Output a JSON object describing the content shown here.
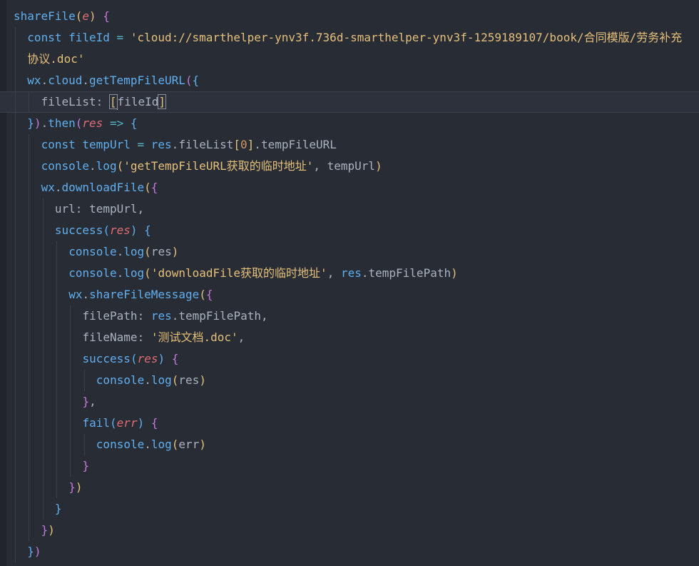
{
  "editor": {
    "lines": [
      {
        "indent": 0,
        "tokens": [
          [
            "t-fn",
            "shareFile"
          ],
          [
            "t-b1",
            "("
          ],
          [
            "t-param",
            "e"
          ],
          [
            "t-b1",
            ")"
          ],
          [
            "t-var",
            " "
          ],
          [
            "t-b2",
            "{"
          ]
        ]
      },
      {
        "indent": 1,
        "tokens": [
          [
            "t-kw",
            "const"
          ],
          [
            "t-var",
            " "
          ],
          [
            "t-obj",
            "fileId"
          ],
          [
            "t-var",
            " "
          ],
          [
            "t-op",
            "="
          ],
          [
            "t-var",
            " "
          ],
          [
            "t-str",
            "'cloud://smarthelper-ynv3f.736d-smarthelper-ynv3f-1259189107/book/合同模版/劳务补充"
          ]
        ]
      },
      {
        "indent": 1,
        "tokens": [
          [
            "t-str",
            "协议.doc'"
          ]
        ]
      },
      {
        "indent": 1,
        "tokens": [
          [
            "t-obj",
            "wx"
          ],
          [
            "t-var",
            "."
          ],
          [
            "t-obj",
            "cloud"
          ],
          [
            "t-var",
            "."
          ],
          [
            "t-fn",
            "getTempFileURL"
          ],
          [
            "t-b2",
            "("
          ],
          [
            "t-b3",
            "{"
          ]
        ]
      },
      {
        "indent": 2,
        "active": true,
        "tokens": [
          [
            "t-prop",
            "fileList"
          ],
          [
            "t-var",
            ": "
          ],
          [
            "t-b1",
            "[",
            "box"
          ],
          [
            "t-prop",
            "fileId"
          ],
          [
            "t-b1",
            "]",
            "box"
          ]
        ]
      },
      {
        "indent": 1,
        "tokens": [
          [
            "t-b3",
            "}"
          ],
          [
            "t-b2",
            ")"
          ],
          [
            "t-var",
            "."
          ],
          [
            "t-fn",
            "then"
          ],
          [
            "t-b2",
            "("
          ],
          [
            "t-param",
            "res"
          ],
          [
            "t-var",
            " "
          ],
          [
            "t-op",
            "=>"
          ],
          [
            "t-var",
            " "
          ],
          [
            "t-b3",
            "{"
          ]
        ]
      },
      {
        "indent": 2,
        "tokens": [
          [
            "t-kw",
            "const"
          ],
          [
            "t-var",
            " "
          ],
          [
            "t-obj",
            "tempUrl"
          ],
          [
            "t-var",
            " "
          ],
          [
            "t-op",
            "="
          ],
          [
            "t-var",
            " "
          ],
          [
            "t-obj",
            "res"
          ],
          [
            "t-var",
            "."
          ],
          [
            "t-prop",
            "fileList"
          ],
          [
            "t-b1",
            "["
          ],
          [
            "t-num",
            "0"
          ],
          [
            "t-b1",
            "]"
          ],
          [
            "t-var",
            "."
          ],
          [
            "t-prop",
            "tempFileURL"
          ]
        ]
      },
      {
        "indent": 2,
        "tokens": [
          [
            "t-obj",
            "console"
          ],
          [
            "t-var",
            "."
          ],
          [
            "t-fn",
            "log"
          ],
          [
            "t-b1",
            "("
          ],
          [
            "t-str",
            "'getTempFileURL获取的临时地址'"
          ],
          [
            "t-var",
            ", "
          ],
          [
            "t-prop",
            "tempUrl"
          ],
          [
            "t-b1",
            ")"
          ]
        ]
      },
      {
        "indent": 2,
        "tokens": [
          [
            "t-obj",
            "wx"
          ],
          [
            "t-var",
            "."
          ],
          [
            "t-fn",
            "downloadFile"
          ],
          [
            "t-b1",
            "("
          ],
          [
            "t-b2",
            "{"
          ]
        ]
      },
      {
        "indent": 3,
        "tokens": [
          [
            "t-prop",
            "url"
          ],
          [
            "t-var",
            ": "
          ],
          [
            "t-prop",
            "tempUrl"
          ],
          [
            "t-var",
            ","
          ]
        ]
      },
      {
        "indent": 3,
        "tokens": [
          [
            "t-fn",
            "success"
          ],
          [
            "t-b3",
            "("
          ],
          [
            "t-param",
            "res"
          ],
          [
            "t-b3",
            ")"
          ],
          [
            "t-var",
            " "
          ],
          [
            "t-b3",
            "{"
          ]
        ]
      },
      {
        "indent": 4,
        "tokens": [
          [
            "t-obj",
            "console"
          ],
          [
            "t-var",
            "."
          ],
          [
            "t-fn",
            "log"
          ],
          [
            "t-b1",
            "("
          ],
          [
            "t-prop",
            "res"
          ],
          [
            "t-b1",
            ")"
          ]
        ]
      },
      {
        "indent": 4,
        "tokens": [
          [
            "t-obj",
            "console"
          ],
          [
            "t-var",
            "."
          ],
          [
            "t-fn",
            "log"
          ],
          [
            "t-b1",
            "("
          ],
          [
            "t-str",
            "'downloadFile获取的临时地址'"
          ],
          [
            "t-var",
            ", "
          ],
          [
            "t-obj",
            "res"
          ],
          [
            "t-var",
            "."
          ],
          [
            "t-prop",
            "tempFilePath"
          ],
          [
            "t-b1",
            ")"
          ]
        ]
      },
      {
        "indent": 4,
        "tokens": [
          [
            "t-obj",
            "wx"
          ],
          [
            "t-var",
            "."
          ],
          [
            "t-fn",
            "shareFileMessage"
          ],
          [
            "t-b1",
            "("
          ],
          [
            "t-b2",
            "{"
          ]
        ]
      },
      {
        "indent": 5,
        "tokens": [
          [
            "t-prop",
            "filePath"
          ],
          [
            "t-var",
            ": "
          ],
          [
            "t-obj",
            "res"
          ],
          [
            "t-var",
            "."
          ],
          [
            "t-prop",
            "tempFilePath"
          ],
          [
            "t-var",
            ","
          ]
        ]
      },
      {
        "indent": 5,
        "tokens": [
          [
            "t-prop",
            "fileName"
          ],
          [
            "t-var",
            ": "
          ],
          [
            "t-str",
            "'测试文档.doc'"
          ],
          [
            "t-var",
            ","
          ]
        ]
      },
      {
        "indent": 5,
        "tokens": [
          [
            "t-fn",
            "success"
          ],
          [
            "t-b3",
            "("
          ],
          [
            "t-param",
            "res"
          ],
          [
            "t-b3",
            ")"
          ],
          [
            "t-var",
            " "
          ],
          [
            "t-b2",
            "{"
          ]
        ]
      },
      {
        "indent": 6,
        "tokens": [
          [
            "t-obj",
            "console"
          ],
          [
            "t-var",
            "."
          ],
          [
            "t-fn",
            "log"
          ],
          [
            "t-b1",
            "("
          ],
          [
            "t-prop",
            "res"
          ],
          [
            "t-b1",
            ")"
          ]
        ]
      },
      {
        "indent": 5,
        "tokens": [
          [
            "t-b2",
            "}"
          ],
          [
            "t-var",
            ","
          ]
        ]
      },
      {
        "indent": 5,
        "tokens": [
          [
            "t-fn",
            "fail"
          ],
          [
            "t-b3",
            "("
          ],
          [
            "t-param",
            "err"
          ],
          [
            "t-b3",
            ")"
          ],
          [
            "t-var",
            " "
          ],
          [
            "t-b2",
            "{"
          ]
        ]
      },
      {
        "indent": 6,
        "tokens": [
          [
            "t-obj",
            "console"
          ],
          [
            "t-var",
            "."
          ],
          [
            "t-fn",
            "log"
          ],
          [
            "t-b1",
            "("
          ],
          [
            "t-prop",
            "err"
          ],
          [
            "t-b1",
            ")"
          ]
        ]
      },
      {
        "indent": 5,
        "tokens": [
          [
            "t-b2",
            "}"
          ]
        ]
      },
      {
        "indent": 4,
        "tokens": [
          [
            "t-b2",
            "}"
          ],
          [
            "t-b1",
            ")"
          ]
        ]
      },
      {
        "indent": 3,
        "tokens": [
          [
            "t-b3",
            "}"
          ]
        ]
      },
      {
        "indent": 2,
        "tokens": [
          [
            "t-b2",
            "}"
          ],
          [
            "t-b1",
            ")"
          ]
        ]
      },
      {
        "indent": 1,
        "tokens": [
          [
            "t-b3",
            "}"
          ],
          [
            "t-b2",
            ")"
          ]
        ]
      }
    ]
  }
}
